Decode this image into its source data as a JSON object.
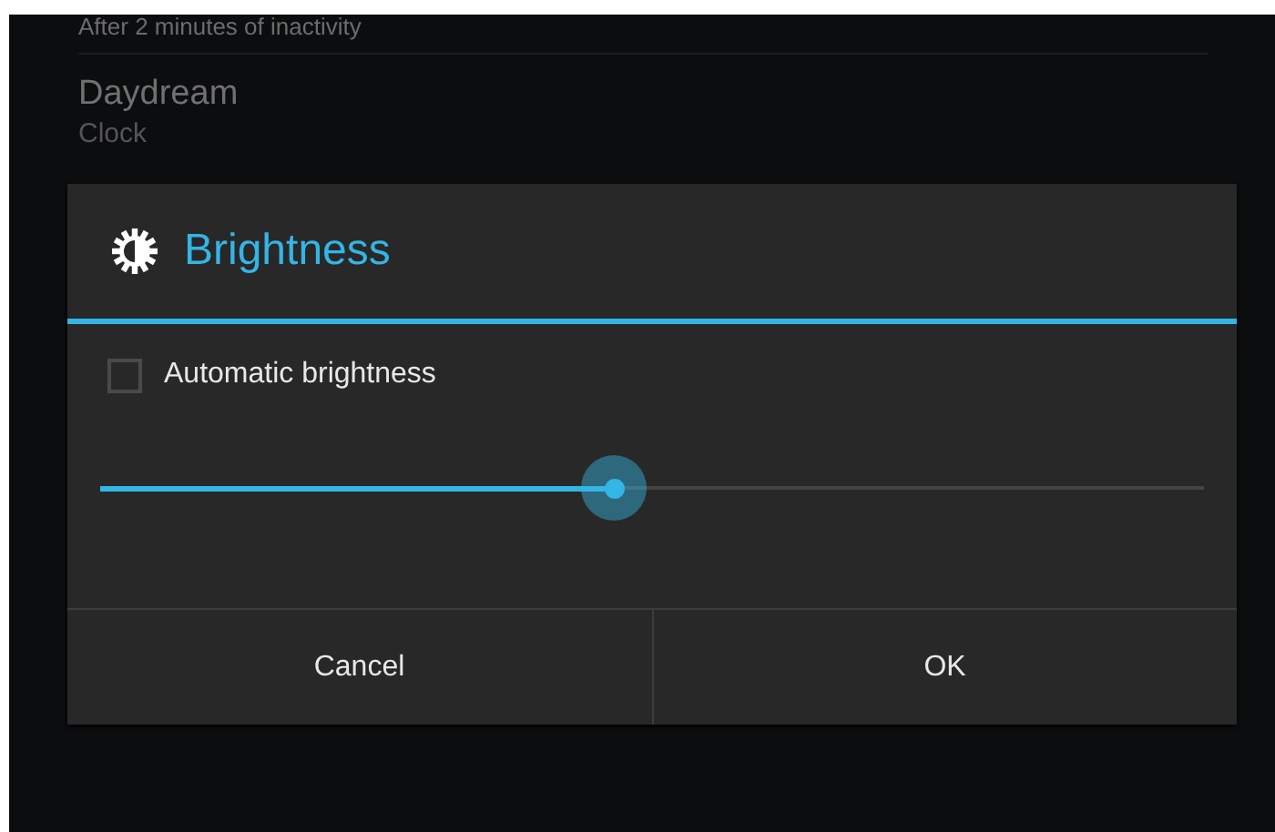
{
  "background_list": [
    {
      "title": "After 2 minutes of inactivity"
    },
    {
      "title": "Daydream",
      "summary": "Clock"
    }
  ],
  "dialog": {
    "title": "Brightness",
    "automatic": {
      "label": "Automatic brightness",
      "checked": false
    },
    "slider": {
      "level": 0.466
    },
    "buttons": [
      "Cancel",
      "OK"
    ]
  }
}
